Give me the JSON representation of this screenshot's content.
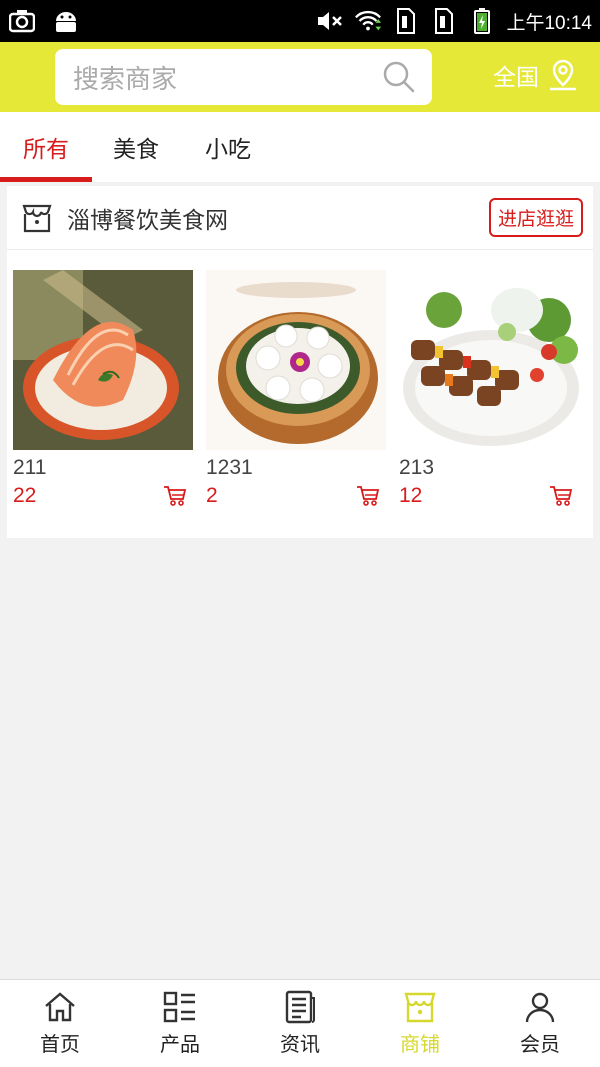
{
  "status_bar": {
    "time": "上午10:14",
    "left_icons": [
      "camera-icon",
      "android-icon"
    ],
    "right_icons": [
      "mute-icon",
      "wifi-icon",
      "sim1-icon",
      "sim2-icon",
      "battery-icon"
    ]
  },
  "header": {
    "search_placeholder": "搜索商家",
    "region_label": "全国",
    "bg_color": "#e6e837"
  },
  "tabs": [
    {
      "label": "所有",
      "active": true
    },
    {
      "label": "美食",
      "active": false
    },
    {
      "label": "小吃",
      "active": false
    }
  ],
  "shop": {
    "name": "淄博餐饮美食网",
    "visit_button": "进店逛逛",
    "products": [
      {
        "name": "211",
        "price": "22",
        "image": "salmon-sashimi"
      },
      {
        "name": "1231",
        "price": "2",
        "image": "steamed-dumplings"
      },
      {
        "name": "213",
        "price": "12",
        "image": "meat-kebabs"
      }
    ]
  },
  "bottom_nav": [
    {
      "label": "首页",
      "icon": "home-icon",
      "active": false
    },
    {
      "label": "产品",
      "icon": "product-list-icon",
      "active": false
    },
    {
      "label": "资讯",
      "icon": "news-icon",
      "active": false
    },
    {
      "label": "商铺",
      "icon": "store-icon",
      "active": true
    },
    {
      "label": "会员",
      "icon": "user-icon",
      "active": false
    }
  ],
  "colors": {
    "accent": "#d81b1b",
    "brand": "#e6e837",
    "nav_active": "#d6d82e"
  }
}
